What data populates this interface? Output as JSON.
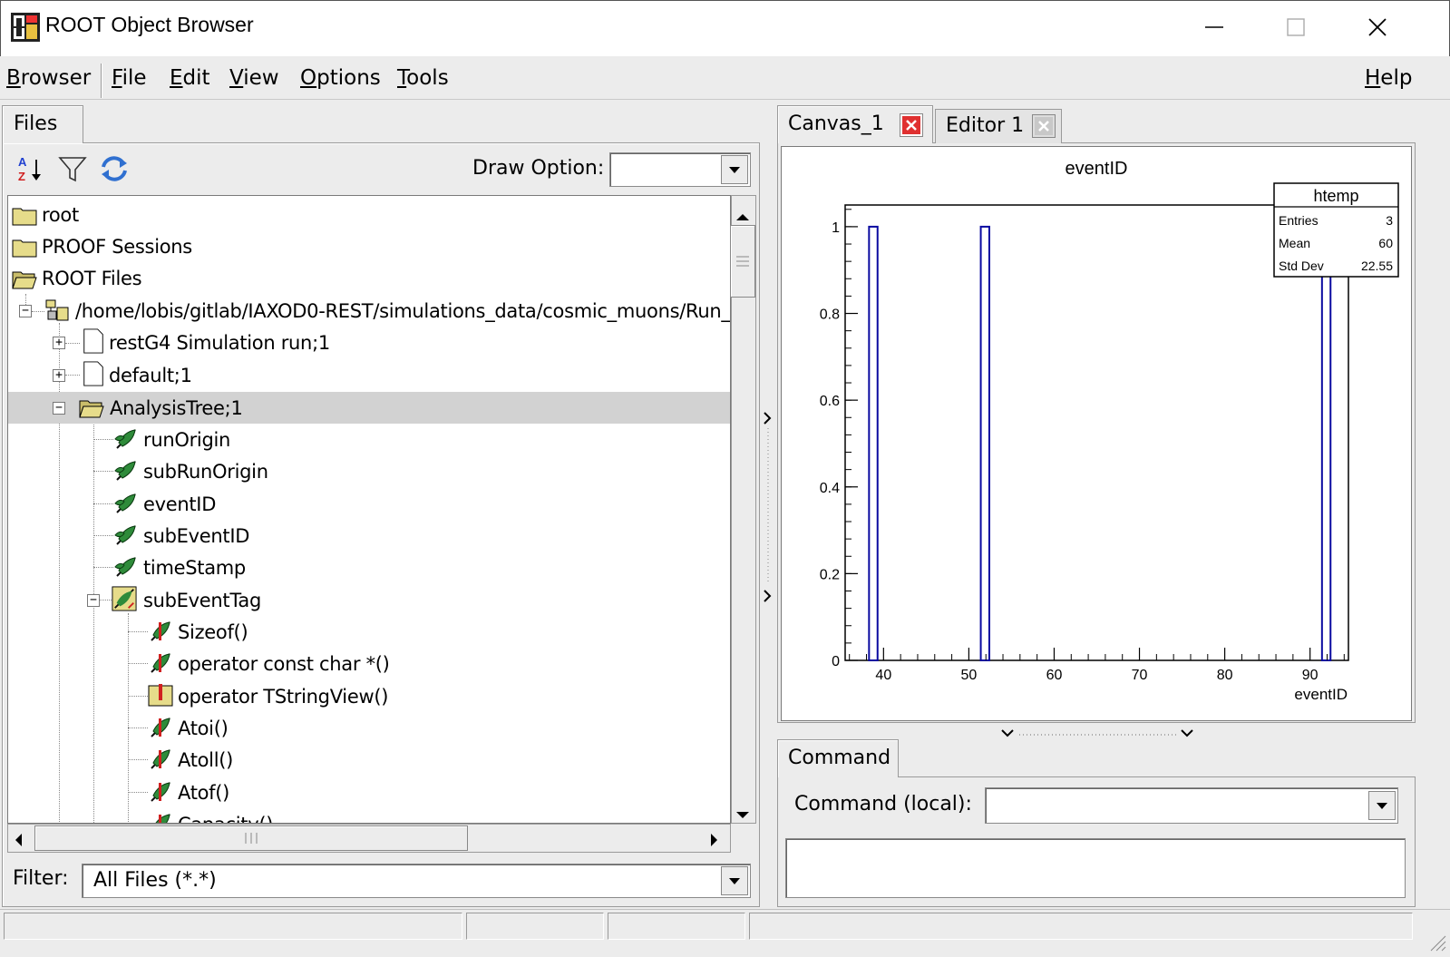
{
  "window": {
    "title": "ROOT Object Browser"
  },
  "menubar": {
    "items": [
      {
        "label": "Browser",
        "u": "B",
        "rest": "rowser"
      },
      {
        "label": "File",
        "u": "F",
        "rest": "ile"
      },
      {
        "label": "Edit",
        "u": "E",
        "rest": "dit"
      },
      {
        "label": "View",
        "u": "V",
        "rest": "iew"
      },
      {
        "label": "Options",
        "u": "O",
        "rest": "ptions"
      },
      {
        "label": "Tools",
        "u": "T",
        "rest": "ools"
      }
    ],
    "help": {
      "label": "Help",
      "u": "H",
      "rest": "elp"
    }
  },
  "left_panel": {
    "tab": "Files",
    "draw_option_label": "Draw Option:",
    "draw_option_value": "",
    "filter_label": "Filter:",
    "filter_value": "All Files (*.*)",
    "tree": [
      {
        "label": "root",
        "icon": "folder-icon"
      },
      {
        "label": "PROOF Sessions",
        "icon": "folder-icon"
      },
      {
        "label": "ROOT Files",
        "icon": "open-folder-icon"
      },
      {
        "label": "/home/lobis/gitlab/IAXOD0-REST/simulations_data/cosmic_muons/Run_SIMULA",
        "icon": "root-file-icon"
      },
      {
        "label": "restG4 Simulation run;1",
        "icon": "document-icon"
      },
      {
        "label": "default;1",
        "icon": "document-icon"
      },
      {
        "label": "AnalysisTree;1",
        "icon": "open-folder-icon"
      },
      {
        "label": "runOrigin",
        "icon": "leaf-icon"
      },
      {
        "label": "subRunOrigin",
        "icon": "leaf-icon"
      },
      {
        "label": "eventID",
        "icon": "leaf-icon"
      },
      {
        "label": "subEventID",
        "icon": "leaf-icon"
      },
      {
        "label": "timeStamp",
        "icon": "leaf-icon"
      },
      {
        "label": "subEventTag",
        "icon": "branch-element-icon"
      },
      {
        "label": "Sizeof()",
        "icon": "method-icon"
      },
      {
        "label": "operator const char *()",
        "icon": "method-icon"
      },
      {
        "label": "operator TStringView()",
        "icon": "method-alt-icon"
      },
      {
        "label": "Atoi()",
        "icon": "method-icon"
      },
      {
        "label": "Atoll()",
        "icon": "method-icon"
      },
      {
        "label": "Atof()",
        "icon": "method-icon"
      },
      {
        "label": "Capacity()",
        "icon": "method-icon"
      }
    ]
  },
  "right_panel": {
    "tabs": [
      {
        "label": "Canvas_1",
        "active": true
      },
      {
        "label": "Editor 1",
        "active": false
      }
    ],
    "command_tab": "Command",
    "command_local_label": "Command (local):",
    "command_value": ""
  },
  "chart_data": {
    "type": "bar",
    "title": "eventID",
    "xlabel": "eventID",
    "ylabel": "",
    "xlim": [
      35.5,
      94.5
    ],
    "ylim": [
      0,
      1.05
    ],
    "x_ticks": [
      40,
      50,
      60,
      70,
      80,
      90
    ],
    "y_ticks": [
      0,
      0.2,
      0.4,
      0.6,
      0.8,
      1
    ],
    "y_tick_labels": [
      "0",
      "0.2",
      "0.4",
      "0.6",
      "0.8",
      "1"
    ],
    "bars": [
      {
        "x0": 38.3,
        "x1": 39.3,
        "value": 1
      },
      {
        "x0": 51.4,
        "x1": 52.4,
        "value": 1
      },
      {
        "x0": 91.4,
        "x1": 92.4,
        "value": 1
      }
    ],
    "color": "#0a0aa0",
    "stats": {
      "title": "htemp",
      "rows": [
        {
          "label": "Entries",
          "value": "3"
        },
        {
          "label": "Mean",
          "value": "60"
        },
        {
          "label": "Std Dev",
          "value": "22.55"
        }
      ]
    }
  }
}
